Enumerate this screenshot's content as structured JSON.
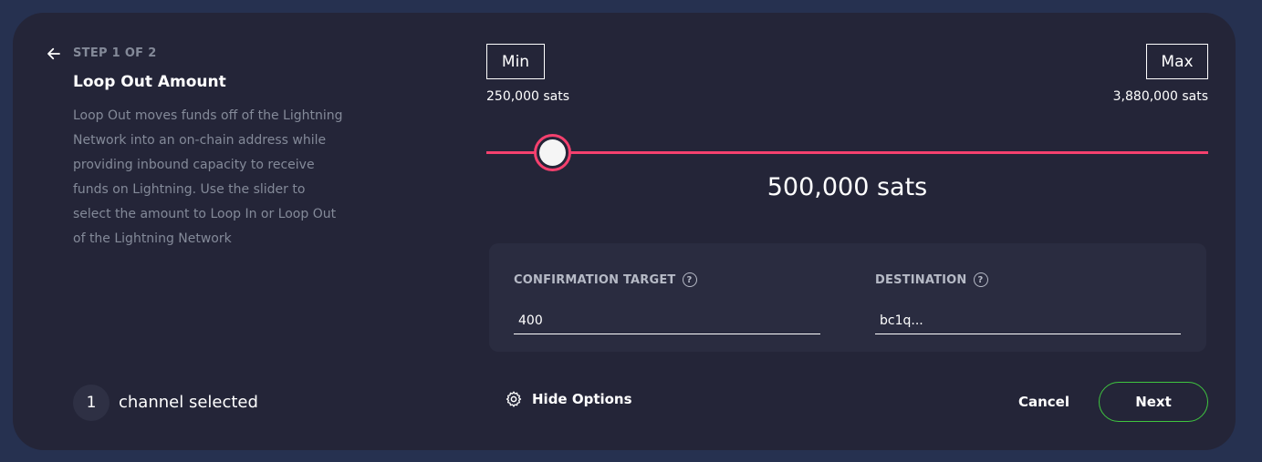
{
  "wizard": {
    "step_label": "STEP 1 OF 2",
    "title": "Loop Out Amount",
    "description": "Loop Out moves funds off of the Lightning Network into an on-chain address while providing inbound capacity to receive funds on Lightning. Use the slider to select the amount to Loop In or Loop Out of the Lightning Network"
  },
  "slider": {
    "min_button": "Min",
    "max_button": "Max",
    "min_value": "250,000 sats",
    "max_value": "3,880,000 sats",
    "current_value": "500,000 sats",
    "min_sats": 250000,
    "max_sats": 3880000,
    "current_sats": 500000,
    "accent_color": "#f5406e"
  },
  "options": {
    "confirmation_target_label": "CONFIRMATION TARGET",
    "confirmation_target_value": "400",
    "destination_label": "DESTINATION",
    "destination_placeholder": "bc1q..."
  },
  "channels": {
    "count": "1",
    "label": "channel selected"
  },
  "footer": {
    "hide_options_label": "Hide Options",
    "cancel_label": "Cancel",
    "next_label": "Next",
    "next_border_color": "#3fc63f"
  },
  "icons": {
    "back": "arrow-left-icon",
    "help": "question-circle-icon",
    "settings": "gear-icon"
  }
}
